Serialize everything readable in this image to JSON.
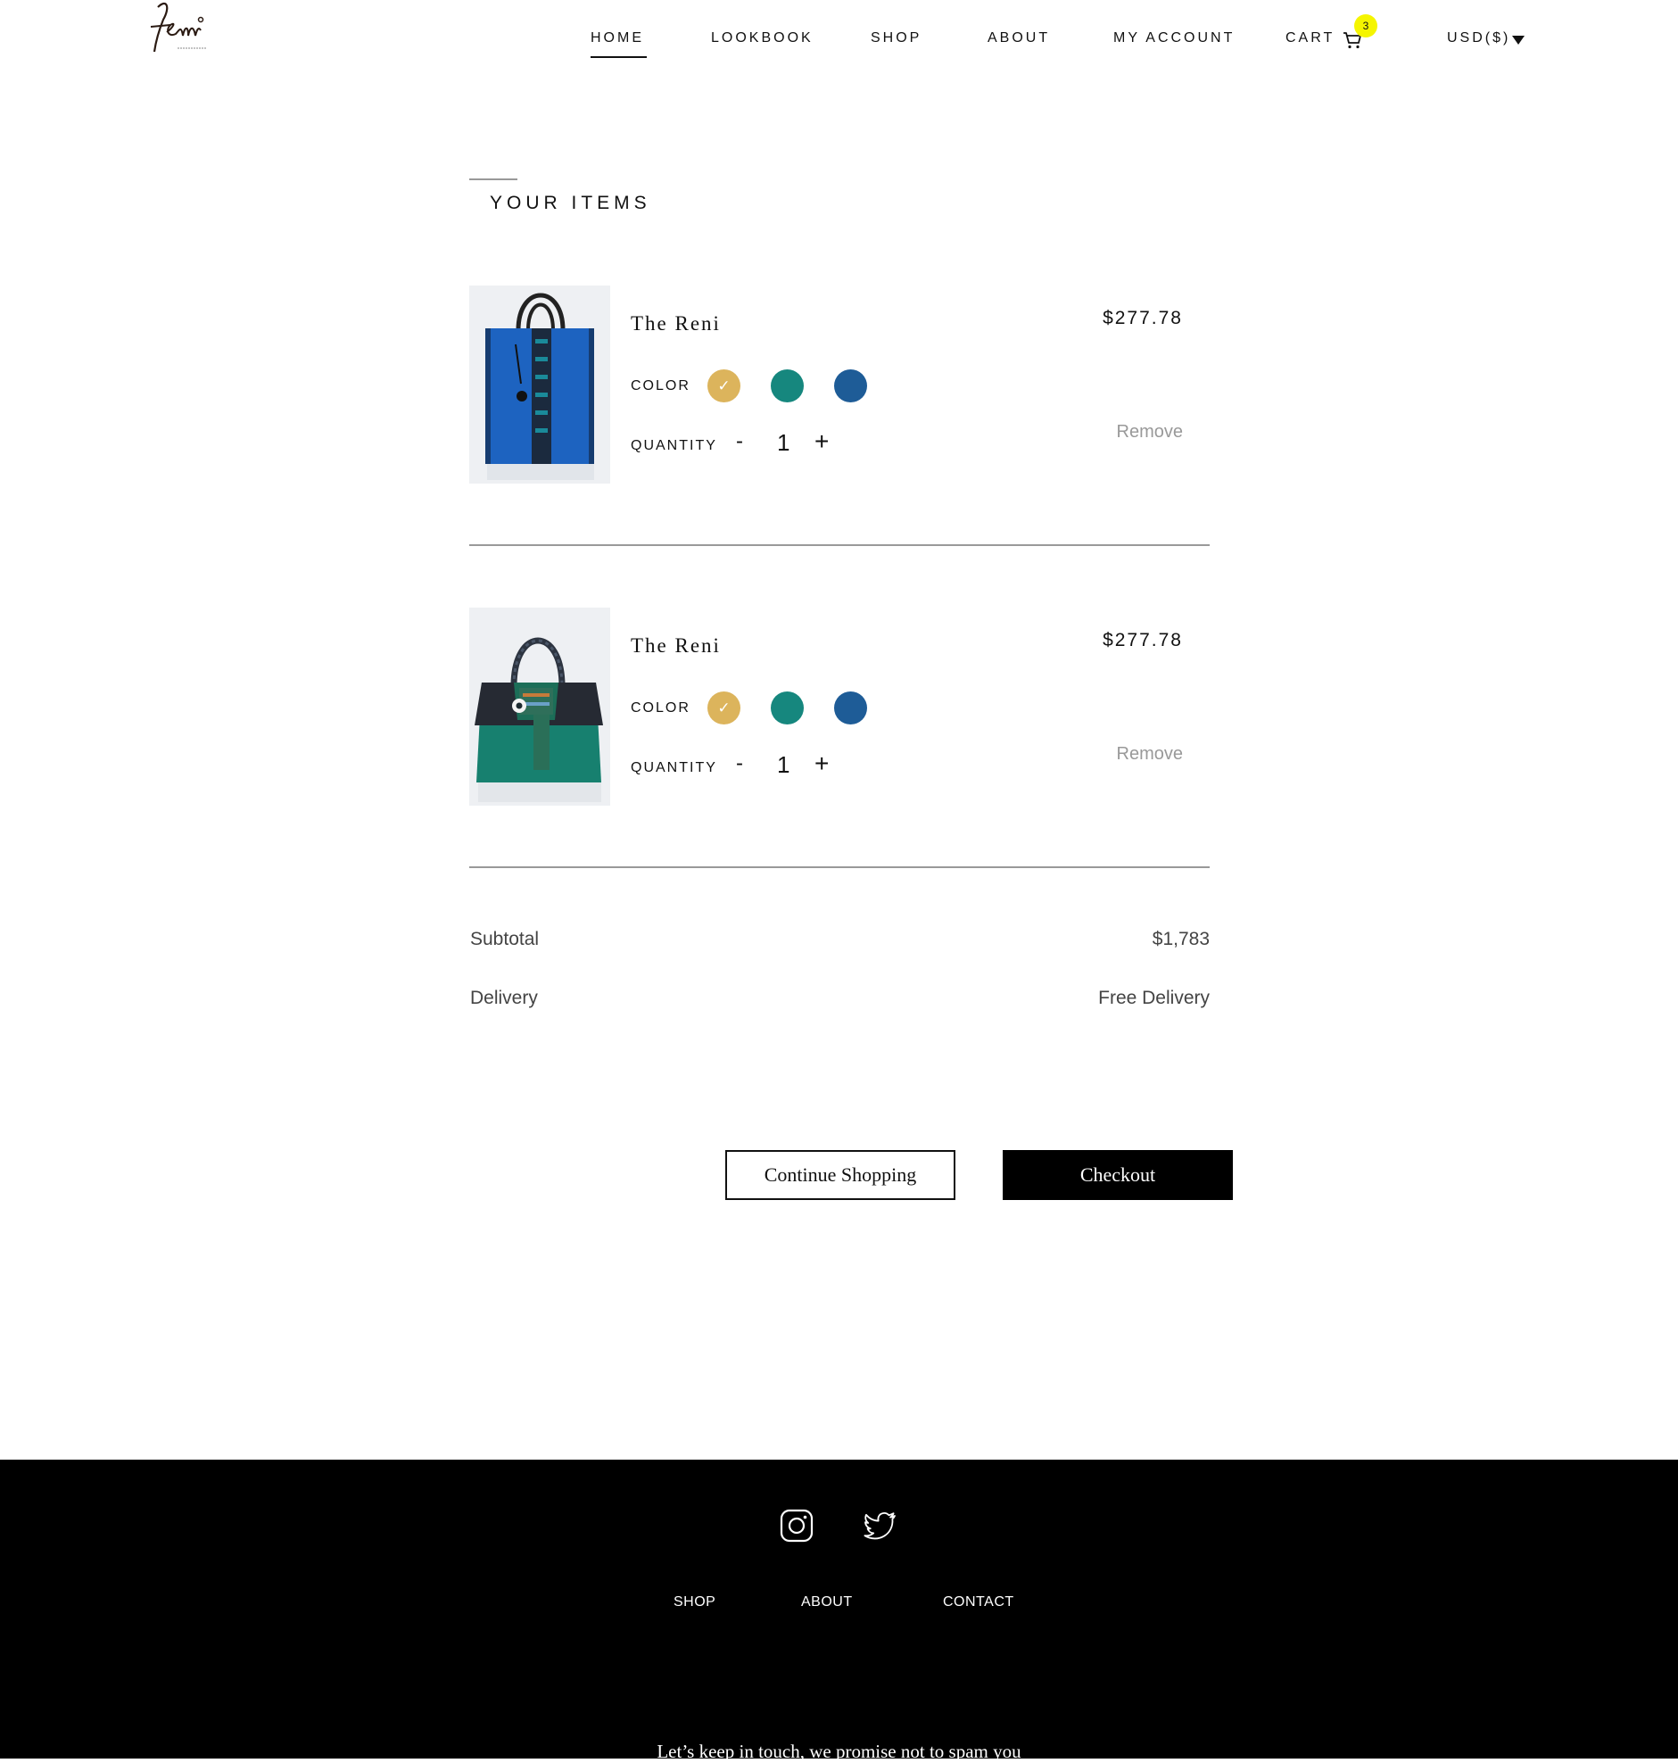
{
  "brand": {
    "logo_alt": "femi handbags"
  },
  "nav": {
    "items": [
      "HOME",
      "LOOKBOOK",
      "SHOP",
      "ABOUT",
      "MY ACCOUNT",
      "CART"
    ],
    "active": "HOME",
    "cart_count": "3",
    "currency": "USD($)"
  },
  "cart": {
    "section_title": "YOUR ITEMS",
    "color_label": "COLOR",
    "quantity_label": "QUANTITY",
    "qty_minus": "-",
    "qty_plus": "+",
    "remove_label": "Remove",
    "swatch_colors": [
      "#dcb45c",
      "#16877e",
      "#1e5c97"
    ],
    "items": [
      {
        "name": "The Reni",
        "price": "$277.78",
        "quantity": "1",
        "selected_color": "#dcb45c"
      },
      {
        "name": "The Reni",
        "price": "$277.78",
        "quantity": "1",
        "selected_color": "#dcb45c"
      }
    ]
  },
  "summary": {
    "subtotal_label": "Subtotal",
    "subtotal_value": "$1,783",
    "delivery_label": "Delivery",
    "delivery_value": "Free Delivery"
  },
  "actions": {
    "continue_label": "Continue Shopping",
    "checkout_label": "Checkout"
  },
  "footer": {
    "social": [
      "instagram-icon",
      "twitter-icon"
    ],
    "links": [
      "SHOP",
      "ABOUT",
      "CONTACT"
    ],
    "newsletter_text": "Let’s keep in touch, we promise not to spam you"
  }
}
